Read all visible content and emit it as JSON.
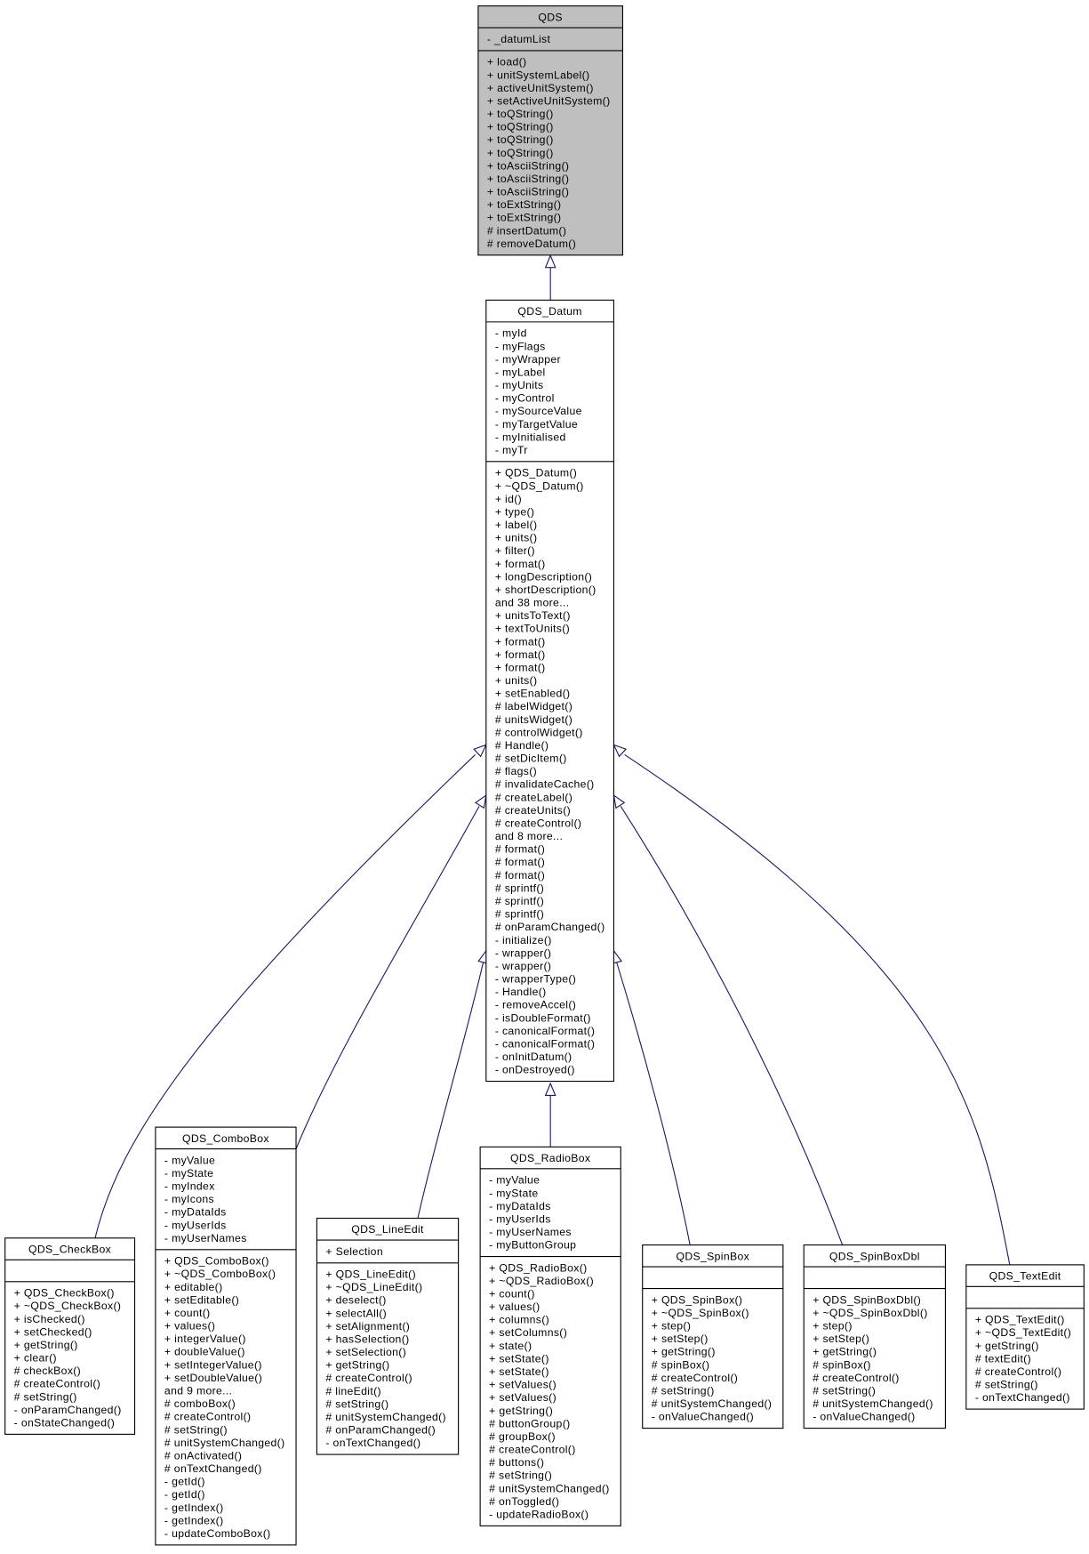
{
  "colors": {
    "edge": "#191970",
    "highlight_fill": "#bfbfbf",
    "box_fill": "#ffffff"
  },
  "classes": [
    {
      "id": "qds",
      "name": "QDS",
      "highlighted": true,
      "attributes": [
        "- _datumList"
      ],
      "methods": [
        "+ load()",
        "+ unitSystemLabel()",
        "+ activeUnitSystem()",
        "+ setActiveUnitSystem()",
        "+ toQString()",
        "+ toQString()",
        "+ toQString()",
        "+ toQString()",
        "+ toAsciiString()",
        "+ toAsciiString()",
        "+ toAsciiString()",
        "+ toExtString()",
        "+ toExtString()",
        "# insertDatum()",
        "# removeDatum()"
      ]
    },
    {
      "id": "datum",
      "name": "QDS_Datum",
      "attributes": [
        "- myId",
        "- myFlags",
        "- myWrapper",
        "- myLabel",
        "- myUnits",
        "- myControl",
        "- mySourceValue",
        "- myTargetValue",
        "- myInitialised",
        "- myTr"
      ],
      "methods": [
        "+ QDS_Datum()",
        "+ ~QDS_Datum()",
        "+ id()",
        "+ type()",
        "+ label()",
        "+ units()",
        "+ filter()",
        "+ format()",
        "+ longDescription()",
        "+ shortDescription()",
        "and 38 more...",
        "+ unitsToText()",
        "+ textToUnits()",
        "+ format()",
        "+ format()",
        "+ format()",
        "+ units()",
        "+ setEnabled()",
        "# labelWidget()",
        "# unitsWidget()",
        "# controlWidget()",
        "# Handle()",
        "# setDicItem()",
        "# flags()",
        "# invalidateCache()",
        "# createLabel()",
        "# createUnits()",
        "# createControl()",
        "and 8 more...",
        "# format()",
        "# format()",
        "# format()",
        "# sprintf()",
        "# sprintf()",
        "# sprintf()",
        "# onParamChanged()",
        "- initialize()",
        "- wrapper()",
        "- wrapper()",
        "- wrapperType()",
        "- Handle()",
        "- removeAccel()",
        "- isDoubleFormat()",
        "- canonicalFormat()",
        "- canonicalFormat()",
        "- onInitDatum()",
        "- onDestroyed()"
      ]
    },
    {
      "id": "checkbox",
      "name": "QDS_CheckBox",
      "attributes": [],
      "methods": [
        "+ QDS_CheckBox()",
        "+ ~QDS_CheckBox()",
        "+ isChecked()",
        "+ setChecked()",
        "+ getString()",
        "+ clear()",
        "# checkBox()",
        "# createControl()",
        "# setString()",
        "- onParamChanged()",
        "- onStateChanged()"
      ]
    },
    {
      "id": "combobox",
      "name": "QDS_ComboBox",
      "attributes": [
        "- myValue",
        "- myState",
        "- myIndex",
        "- myIcons",
        "- myDataIds",
        "- myUserIds",
        "- myUserNames"
      ],
      "methods": [
        "+ QDS_ComboBox()",
        "+ ~QDS_ComboBox()",
        "+ editable()",
        "+ setEditable()",
        "+ count()",
        "+ values()",
        "+ integerValue()",
        "+ doubleValue()",
        "+ setIntegerValue()",
        "+ setDoubleValue()",
        "and 9 more...",
        "# comboBox()",
        "# createControl()",
        "# setString()",
        "# unitSystemChanged()",
        "# onActivated()",
        "# onTextChanged()",
        "- getId()",
        "- getId()",
        "- getIndex()",
        "- getIndex()",
        "- updateComboBox()"
      ]
    },
    {
      "id": "lineedit",
      "name": "QDS_LineEdit",
      "attributes": [
        "+ Selection"
      ],
      "methods": [
        "+ QDS_LineEdit()",
        "+ ~QDS_LineEdit()",
        "+ deselect()",
        "+ selectAll()",
        "+ setAlignment()",
        "+ hasSelection()",
        "+ setSelection()",
        "+ getString()",
        "# createControl()",
        "# lineEdit()",
        "# setString()",
        "# unitSystemChanged()",
        "# onParamChanged()",
        "- onTextChanged()"
      ]
    },
    {
      "id": "radiobox",
      "name": "QDS_RadioBox",
      "attributes": [
        "- myValue",
        "- myState",
        "- myDataIds",
        "- myUserIds",
        "- myUserNames",
        "- myButtonGroup"
      ],
      "methods": [
        "+ QDS_RadioBox()",
        "+ ~QDS_RadioBox()",
        "+ count()",
        "+ values()",
        "+ columns()",
        "+ setColumns()",
        "+ state()",
        "+ setState()",
        "+ setState()",
        "+ setValues()",
        "+ setValues()",
        "+ getString()",
        "# buttonGroup()",
        "# groupBox()",
        "# createControl()",
        "# buttons()",
        "# setString()",
        "# unitSystemChanged()",
        "# onToggled()",
        "- updateRadioBox()"
      ]
    },
    {
      "id": "spinbox",
      "name": "QDS_SpinBox",
      "attributes": [],
      "methods": [
        "+ QDS_SpinBox()",
        "+ ~QDS_SpinBox()",
        "+ step()",
        "+ setStep()",
        "+ getString()",
        "# spinBox()",
        "# createControl()",
        "# setString()",
        "# unitSystemChanged()",
        "- onValueChanged()"
      ]
    },
    {
      "id": "spinboxdbl",
      "name": "QDS_SpinBoxDbl",
      "attributes": [],
      "methods": [
        "+ QDS_SpinBoxDbl()",
        "+ ~QDS_SpinBoxDbl()",
        "+ step()",
        "+ setStep()",
        "+ getString()",
        "# spinBox()",
        "# createControl()",
        "# setString()",
        "# unitSystemChanged()",
        "- onValueChanged()"
      ]
    },
    {
      "id": "textedit",
      "name": "QDS_TextEdit",
      "attributes": [],
      "methods": [
        "+ QDS_TextEdit()",
        "+ ~QDS_TextEdit()",
        "+ getString()",
        "# textEdit()",
        "# createControl()",
        "# setString()",
        "- onTextChanged()"
      ]
    }
  ],
  "inheritance": [
    {
      "child": "datum",
      "parent": "qds"
    },
    {
      "child": "checkbox",
      "parent": "datum"
    },
    {
      "child": "combobox",
      "parent": "datum"
    },
    {
      "child": "lineedit",
      "parent": "datum"
    },
    {
      "child": "radiobox",
      "parent": "datum"
    },
    {
      "child": "spinbox",
      "parent": "datum"
    },
    {
      "child": "spinboxdbl",
      "parent": "datum"
    },
    {
      "child": "textedit",
      "parent": "datum"
    }
  ]
}
